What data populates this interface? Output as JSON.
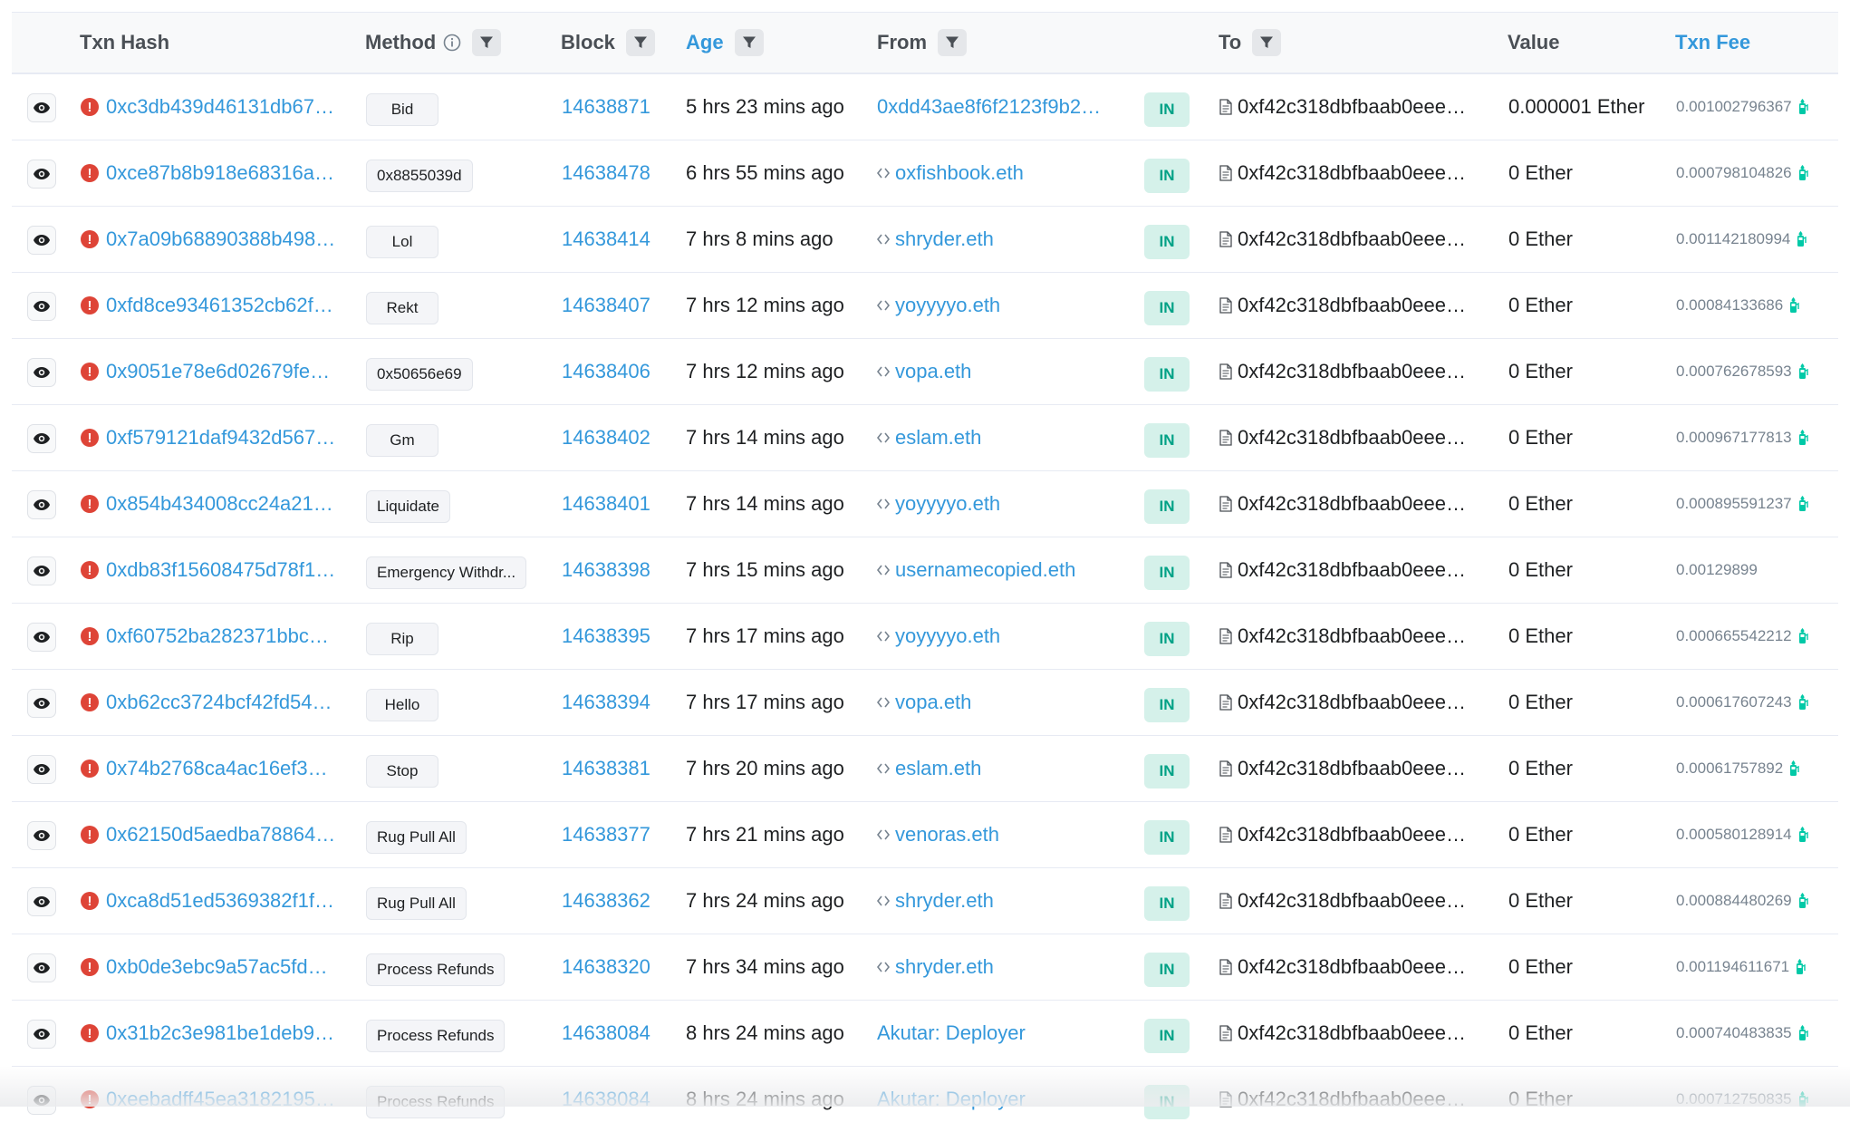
{
  "header": {
    "txn_hash": "Txn Hash",
    "method": "Method",
    "block": "Block",
    "age": "Age",
    "from": "From",
    "to": "To",
    "value": "Value",
    "txn_fee": "Txn Fee"
  },
  "icons": {
    "eye": "eye-icon",
    "error": "exclamation-circle-icon",
    "filter": "filter-icon",
    "info": "info-circle-icon",
    "contract": "document-icon",
    "ens": "code-brackets-icon",
    "gas": "gas-pump-icon"
  },
  "colors": {
    "link": "#3498db",
    "error": "#de4437",
    "in_badge_bg": "#d5f1ea",
    "in_badge_text": "#00a186",
    "gas_icon": "#00c9a7"
  },
  "rows": [
    {
      "hash": "0xc3db439d46131db67…",
      "method": "Bid",
      "block": "14638871",
      "age": "5 hrs 23 mins ago",
      "from": "0xdd43ae8f6f2123f9b2…",
      "from_ens": false,
      "direction": "IN",
      "to": "0xf42c318dbfbaab0eee…",
      "value": "0.000001 Ether",
      "fee": "0.001002796367",
      "gas": true
    },
    {
      "hash": "0xce87b8b918e68316a…",
      "method": "0x8855039d",
      "block": "14638478",
      "age": "6 hrs 55 mins ago",
      "from": "oxfishbook.eth",
      "from_ens": true,
      "direction": "IN",
      "to": "0xf42c318dbfbaab0eee…",
      "value": "0 Ether",
      "fee": "0.000798104826",
      "gas": true
    },
    {
      "hash": "0x7a09b68890388b498…",
      "method": "Lol",
      "block": "14638414",
      "age": "7 hrs 8 mins ago",
      "from": "shryder.eth",
      "from_ens": true,
      "direction": "IN",
      "to": "0xf42c318dbfbaab0eee…",
      "value": "0 Ether",
      "fee": "0.001142180994",
      "gas": true
    },
    {
      "hash": "0xfd8ce93461352cb62f…",
      "method": "Rekt",
      "block": "14638407",
      "age": "7 hrs 12 mins ago",
      "from": "yoyyyyo.eth",
      "from_ens": true,
      "direction": "IN",
      "to": "0xf42c318dbfbaab0eee…",
      "value": "0 Ether",
      "fee": "0.00084133686",
      "gas": true
    },
    {
      "hash": "0x9051e78e6d02679fe…",
      "method": "0x50656e69",
      "block": "14638406",
      "age": "7 hrs 12 mins ago",
      "from": "vopa.eth",
      "from_ens": true,
      "direction": "IN",
      "to": "0xf42c318dbfbaab0eee…",
      "value": "0 Ether",
      "fee": "0.000762678593",
      "gas": true
    },
    {
      "hash": "0xf579121daf9432d567…",
      "method": "Gm",
      "block": "14638402",
      "age": "7 hrs 14 mins ago",
      "from": "eslam.eth",
      "from_ens": true,
      "direction": "IN",
      "to": "0xf42c318dbfbaab0eee…",
      "value": "0 Ether",
      "fee": "0.000967177813",
      "gas": true
    },
    {
      "hash": "0x854b434008cc24a21…",
      "method": "Liquidate",
      "block": "14638401",
      "age": "7 hrs 14 mins ago",
      "from": "yoyyyyo.eth",
      "from_ens": true,
      "direction": "IN",
      "to": "0xf42c318dbfbaab0eee…",
      "value": "0 Ether",
      "fee": "0.000895591237",
      "gas": true
    },
    {
      "hash": "0xdb83f15608475d78f1…",
      "method": "Emergency Withdr...",
      "block": "14638398",
      "age": "7 hrs 15 mins ago",
      "from": "usernamecopied.eth",
      "from_ens": true,
      "direction": "IN",
      "to": "0xf42c318dbfbaab0eee…",
      "value": "0 Ether",
      "fee": "0.00129899",
      "gas": false
    },
    {
      "hash": "0xf60752ba282371bbc…",
      "method": "Rip",
      "block": "14638395",
      "age": "7 hrs 17 mins ago",
      "from": "yoyyyyo.eth",
      "from_ens": true,
      "direction": "IN",
      "to": "0xf42c318dbfbaab0eee…",
      "value": "0 Ether",
      "fee": "0.000665542212",
      "gas": true
    },
    {
      "hash": "0xb62cc3724bcf42fd54…",
      "method": "Hello",
      "block": "14638394",
      "age": "7 hrs 17 mins ago",
      "from": "vopa.eth",
      "from_ens": true,
      "direction": "IN",
      "to": "0xf42c318dbfbaab0eee…",
      "value": "0 Ether",
      "fee": "0.000617607243",
      "gas": true
    },
    {
      "hash": "0x74b2768ca4ac16ef3…",
      "method": "Stop",
      "block": "14638381",
      "age": "7 hrs 20 mins ago",
      "from": "eslam.eth",
      "from_ens": true,
      "direction": "IN",
      "to": "0xf42c318dbfbaab0eee…",
      "value": "0 Ether",
      "fee": "0.00061757892",
      "gas": true
    },
    {
      "hash": "0x62150d5aedba78864…",
      "method": "Rug Pull All",
      "block": "14638377",
      "age": "7 hrs 21 mins ago",
      "from": "venoras.eth",
      "from_ens": true,
      "direction": "IN",
      "to": "0xf42c318dbfbaab0eee…",
      "value": "0 Ether",
      "fee": "0.000580128914",
      "gas": true
    },
    {
      "hash": "0xca8d51ed5369382f1f…",
      "method": "Rug Pull All",
      "block": "14638362",
      "age": "7 hrs 24 mins ago",
      "from": "shryder.eth",
      "from_ens": true,
      "direction": "IN",
      "to": "0xf42c318dbfbaab0eee…",
      "value": "0 Ether",
      "fee": "0.000884480269",
      "gas": true
    },
    {
      "hash": "0xb0de3ebc9a57ac5fd…",
      "method": "Process Refunds",
      "block": "14638320",
      "age": "7 hrs 34 mins ago",
      "from": "shryder.eth",
      "from_ens": true,
      "direction": "IN",
      "to": "0xf42c318dbfbaab0eee…",
      "value": "0 Ether",
      "fee": "0.001194611671",
      "gas": true
    },
    {
      "hash": "0x31b2c3e981be1deb9…",
      "method": "Process Refunds",
      "block": "14638084",
      "age": "8 hrs 24 mins ago",
      "from": "Akutar: Deployer",
      "from_ens": false,
      "direction": "IN",
      "to": "0xf42c318dbfbaab0eee…",
      "value": "0 Ether",
      "fee": "0.000740483835",
      "gas": true
    },
    {
      "hash": "0xeebadff45ea3182195…",
      "method": "Process Refunds",
      "block": "14638084",
      "age": "8 hrs 24 mins ago",
      "from": "Akutar: Deployer",
      "from_ens": false,
      "direction": "IN",
      "to": "0xf42c318dbfbaab0eee…",
      "value": "0 Ether",
      "fee": "0.000712750835",
      "gas": true
    }
  ]
}
